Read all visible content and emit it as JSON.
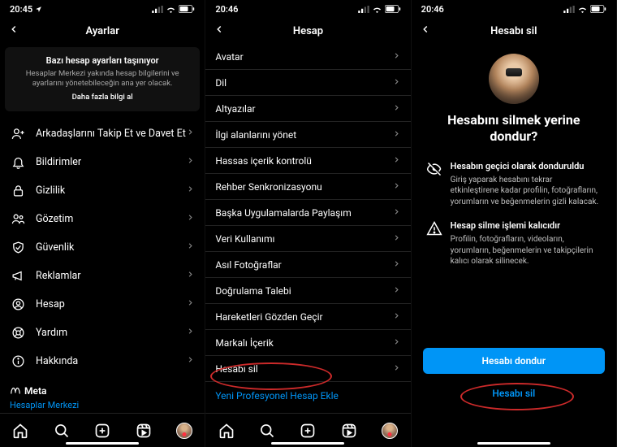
{
  "status": {
    "time1": "20:45",
    "time2": "20:46",
    "time3": "20:46"
  },
  "p1": {
    "title": "Ayarlar",
    "banner_title": "Bazı hesap ayarları taşınıyor",
    "banner_sub": "Hesaplar Merkezi yakında hesap bilgilerini ve ayarlarını yönetebileceğin ana yer olacak.",
    "banner_link": "Daha fazla bilgi al",
    "rows": {
      "r1": "Arkadaşlarını Takip Et ve Davet Et",
      "r2": "Bildirimler",
      "r3": "Gizlilik",
      "r4": "Gözetim",
      "r5": "Güvenlik",
      "r6": "Reklamlar",
      "r7": "Hesap",
      "r8": "Yardım",
      "r9": "Hakkında"
    },
    "meta": "Meta",
    "accounts_center": "Hesaplar Merkezi"
  },
  "p2": {
    "title": "Hesap",
    "rows": {
      "r1": "Avatar",
      "r2": "Dil",
      "r3": "Altyazılar",
      "r4": "İlgi alanlarını yönet",
      "r5": "Hassas içerik kontrolü",
      "r6": "Rehber Senkronizasyonu",
      "r7": "Başka Uygulamalarda Paylaşım",
      "r8": "Veri Kullanımı",
      "r9": "Asıl Fotoğraflar",
      "r10": "Doğrulama Talebi",
      "r11": "Hareketleri Gözden Geçir",
      "r12": "Markalı İçerik",
      "r13": "Hesabı sil"
    },
    "add_pro": "Yeni Profesyonel Hesap Ekle"
  },
  "p3": {
    "title": "Hesabı sil",
    "heading": "Hesabını silmek yerine dondur?",
    "b1_h": "Hesabın geçici olarak donduruldu",
    "b1_t": "Giriş yaparak hesabını tekrar etkinleştirene kadar profilin, fotoğrafların, yorumların ve beğenmelerin gizli kalacak.",
    "b2_h": "Hesap silme işlemi kalıcıdır",
    "b2_t": "Profilin, fotoğrafların, videoların, yorumların, beğenmelerin ve takipçilerin kalıcı olarak silinecek.",
    "btn_freeze": "Hesabı dondur",
    "btn_delete": "Hesabı sil"
  }
}
